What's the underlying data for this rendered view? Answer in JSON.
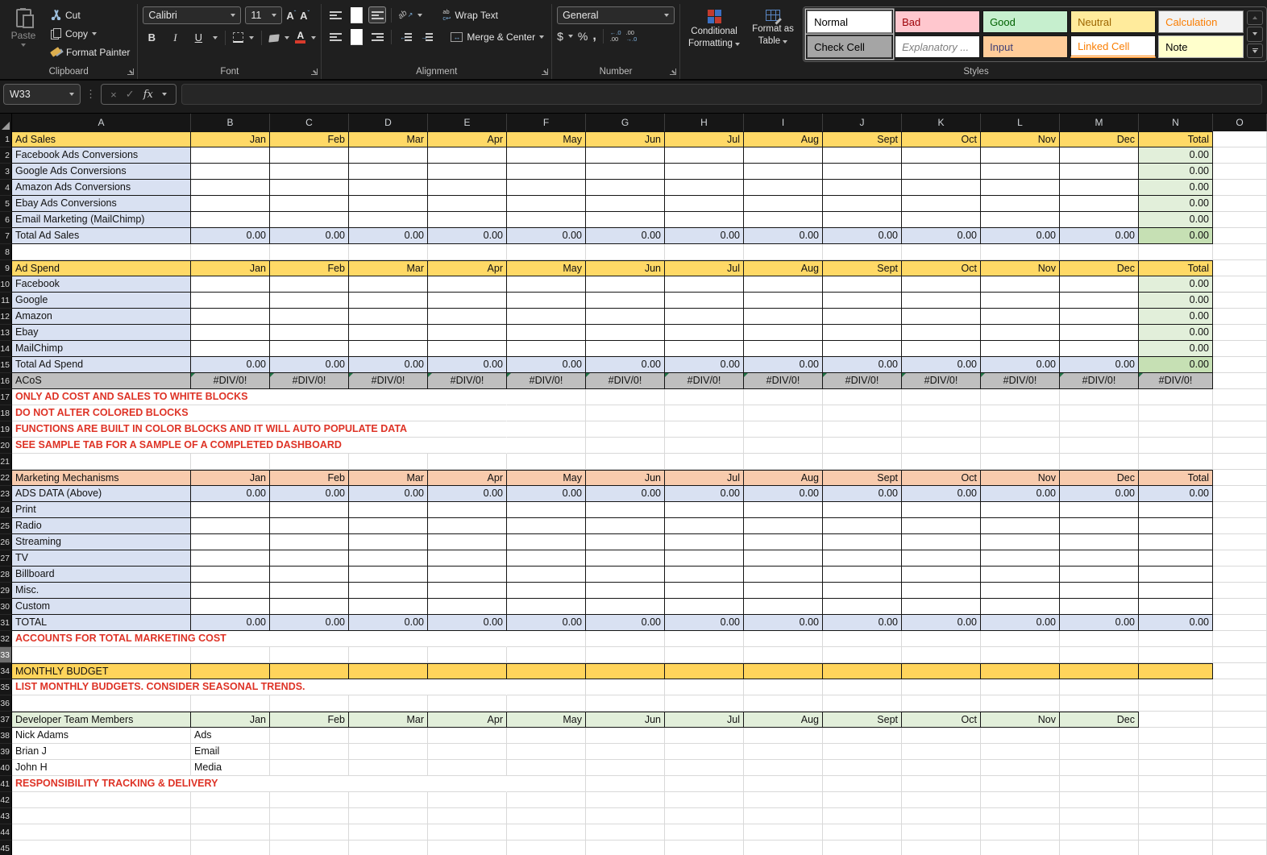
{
  "ribbon": {
    "clipboard": {
      "label": "Clipboard",
      "paste": "Paste",
      "cut": "Cut",
      "copy": "Copy",
      "format_painter": "Format Painter"
    },
    "font": {
      "label": "Font",
      "name": "Calibri",
      "size": "11",
      "bold": "B",
      "italic": "I",
      "underline": "U"
    },
    "alignment": {
      "label": "Alignment",
      "wrap": "Wrap Text",
      "merge": "Merge & Center",
      "orientation": "ab"
    },
    "number": {
      "label": "Number",
      "format": "General",
      "currency": "$",
      "percent": "%",
      "comma": ",",
      "inc_decimal_top": "←.0",
      "inc_decimal_bot": ".00",
      "dec_decimal_top": ".00",
      "dec_decimal_bot": "→.0"
    },
    "styles": {
      "label": "Styles",
      "conditional_line1": "Conditional",
      "conditional_line2": "Formatting",
      "table_line1": "Format as",
      "table_line2": "Table",
      "gallery": [
        {
          "name": "Normal",
          "bg": "#FFFFFF",
          "fg": "#000000",
          "border": "#7F7F7F",
          "ring": true
        },
        {
          "name": "Bad",
          "bg": "#FFC7CE",
          "fg": "#9C0006"
        },
        {
          "name": "Good",
          "bg": "#C6EFCE",
          "fg": "#006100"
        },
        {
          "name": "Neutral",
          "bg": "#FFEB9C",
          "fg": "#9C6500"
        },
        {
          "name": "Calculation",
          "bg": "#F2F2F2",
          "fg": "#FA7D00",
          "border": "#7F7F7F"
        },
        {
          "name": "Check Cell",
          "bg": "#A5A5A5",
          "fg": "#000000",
          "border": "#3F3F3F",
          "ring": true
        },
        {
          "name": "Explanatory ...",
          "bg": "#FFFFFF",
          "fg": "#7F7F7F",
          "italic": true
        },
        {
          "name": "Input",
          "bg": "#FFCC99",
          "fg": "#3F3F76"
        },
        {
          "name": "Linked Cell",
          "bg": "#FFFFFF",
          "fg": "#FA7D00",
          "underline": "#FF8001"
        },
        {
          "name": "Note",
          "bg": "#FFFFCC",
          "fg": "#000000",
          "border": "#B2B2B2"
        }
      ]
    }
  },
  "formula_bar": {
    "name_box": "W33",
    "formula": ""
  },
  "sheet": {
    "zero": "0.00",
    "error": "#DIV/0!",
    "columns": [
      "A",
      "B",
      "C",
      "D",
      "E",
      "F",
      "G",
      "H",
      "I",
      "J",
      "K",
      "L",
      "M",
      "N",
      "O"
    ],
    "months": [
      "Jan",
      "Feb",
      "Mar",
      "Apr",
      "May",
      "Jun",
      "Jul",
      "Aug",
      "Sept",
      "Oct",
      "Nov",
      "Dec"
    ],
    "total_label": "Total",
    "colors": {
      "gold": "#FFD966",
      "budget_gold": "#FFD45B",
      "lavender": "#D9E1F2",
      "green_light": "#E2EFDA",
      "green_dark": "#C6E0B4",
      "grey": "#BFBFBF",
      "peach": "#F8CBAD",
      "dev_green": "#E2EFDA",
      "red": "#DE3326",
      "grid_line": "#D9D9D9",
      "border_black": "#151515",
      "error_triangle": "#217346"
    },
    "rows": [
      {
        "n": 1,
        "kind": "header",
        "fill": "gold",
        "label": "Ad Sales",
        "total": true
      },
      {
        "n": 2,
        "kind": "item",
        "label": "Facebook Ads Conversions"
      },
      {
        "n": 3,
        "kind": "item",
        "label": "Google Ads Conversions"
      },
      {
        "n": 4,
        "kind": "item",
        "label": "Amazon Ads Conversions"
      },
      {
        "n": 5,
        "kind": "item",
        "label": "Ebay Ads Conversions"
      },
      {
        "n": 6,
        "kind": "item",
        "label": "Email Marketing (MailChimp)"
      },
      {
        "n": 7,
        "kind": "totalrow",
        "label": "Total Ad Sales"
      },
      {
        "n": 8,
        "kind": "blank"
      },
      {
        "n": 9,
        "kind": "header",
        "fill": "gold",
        "label": "Ad Spend",
        "total": true
      },
      {
        "n": 10,
        "kind": "item",
        "label": "Facebook"
      },
      {
        "n": 11,
        "kind": "item",
        "label": "Google"
      },
      {
        "n": 12,
        "kind": "item",
        "label": "Amazon"
      },
      {
        "n": 13,
        "kind": "item",
        "label": "Ebay"
      },
      {
        "n": 14,
        "kind": "item",
        "label": "MailChimp"
      },
      {
        "n": 15,
        "kind": "totalrow",
        "label": "Total Ad Spend"
      },
      {
        "n": 16,
        "kind": "acos",
        "label": "ACoS"
      },
      {
        "n": 17,
        "kind": "note",
        "text": "ONLY AD COST AND SALES TO WHITE BLOCKS"
      },
      {
        "n": 18,
        "kind": "note",
        "text": "DO NOT ALTER COLORED BLOCKS"
      },
      {
        "n": 19,
        "kind": "note",
        "text": "FUNCTIONS ARE BUILT IN COLOR BLOCKS AND IT WILL AUTO POPULATE DATA"
      },
      {
        "n": 20,
        "kind": "note",
        "text": "SEE SAMPLE TAB FOR A SAMPLE OF A COMPLETED DASHBOARD"
      },
      {
        "n": 21,
        "kind": "blank"
      },
      {
        "n": 22,
        "kind": "header",
        "fill": "peach",
        "label": "Marketing Mechanisms",
        "total": true
      },
      {
        "n": 23,
        "kind": "fullvals",
        "label": "ADS DATA (Above)"
      },
      {
        "n": 24,
        "kind": "item2",
        "label": "Print"
      },
      {
        "n": 25,
        "kind": "item2",
        "label": "Radio"
      },
      {
        "n": 26,
        "kind": "item2",
        "label": "Streaming"
      },
      {
        "n": 27,
        "kind": "item2",
        "label": "TV"
      },
      {
        "n": 28,
        "kind": "item2",
        "label": "Billboard"
      },
      {
        "n": 29,
        "kind": "item2",
        "label": "Misc."
      },
      {
        "n": 30,
        "kind": "item2",
        "label": "Custom"
      },
      {
        "n": 31,
        "kind": "fullvals",
        "label": "TOTAL"
      },
      {
        "n": 32,
        "kind": "note",
        "text": "ACCOUNTS FOR TOTAL MARKETING COST"
      },
      {
        "n": 33,
        "kind": "blank",
        "hl": true
      },
      {
        "n": 34,
        "kind": "budget",
        "label": "MONTHLY BUDGET"
      },
      {
        "n": 35,
        "kind": "note",
        "text": "LIST MONTHLY BUDGETS. CONSIDER SEASONAL TRENDS."
      },
      {
        "n": 36,
        "kind": "blank"
      },
      {
        "n": 37,
        "kind": "header",
        "fill": "dev",
        "label": "Developer Team Members",
        "total": false
      },
      {
        "n": 38,
        "kind": "member",
        "name": "Nick Adams",
        "role": "Ads"
      },
      {
        "n": 39,
        "kind": "member",
        "name": "Brian J",
        "role": "Email"
      },
      {
        "n": 40,
        "kind": "member",
        "name": "John H",
        "role": "Media"
      },
      {
        "n": 41,
        "kind": "note",
        "text": "RESPONSIBILITY TRACKING & DELIVERY"
      },
      {
        "n": 42,
        "kind": "blank"
      },
      {
        "n": 43,
        "kind": "blank"
      },
      {
        "n": 44,
        "kind": "blank"
      },
      {
        "n": 45,
        "kind": "blank"
      }
    ]
  }
}
